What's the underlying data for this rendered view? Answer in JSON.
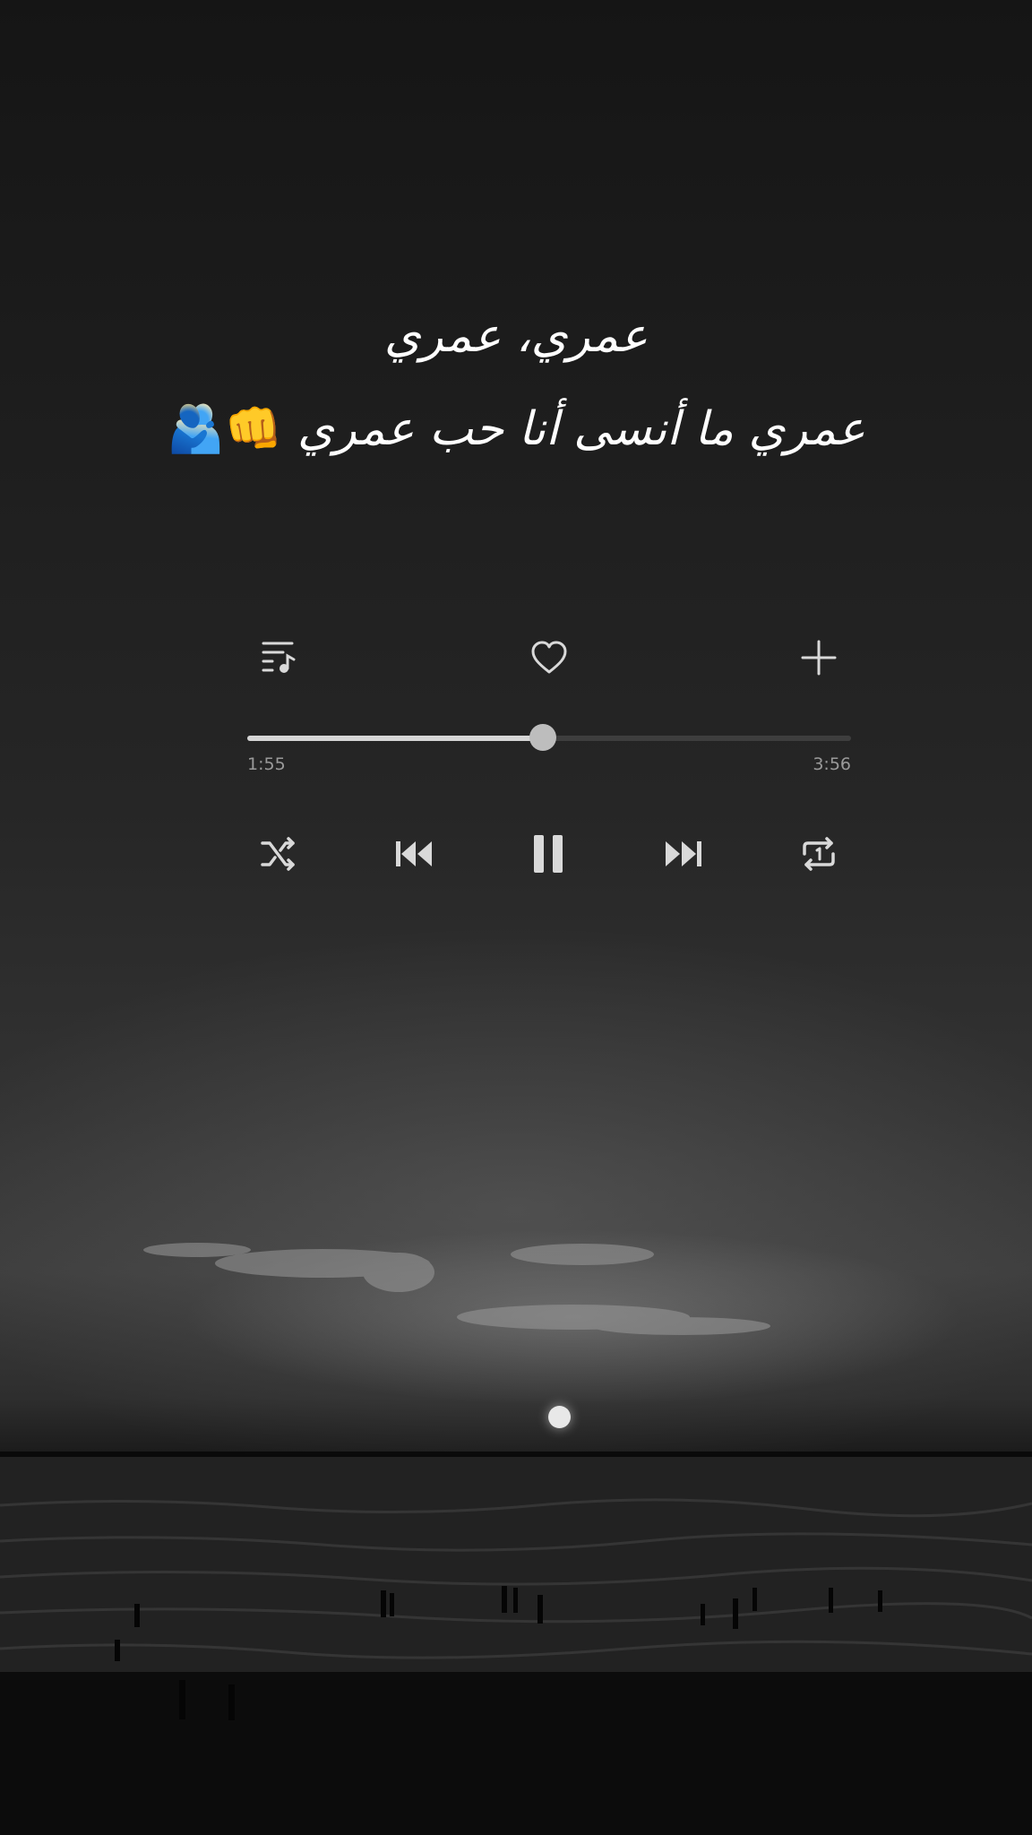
{
  "lyrics": {
    "line1": "عمري، عمري",
    "line2_text": "عمري ما أنسى أنا حب عمري",
    "line2_emoji": "👊🫂"
  },
  "player": {
    "progress_fraction": 0.49,
    "time_elapsed": "1:55",
    "time_total": "3:56",
    "top_controls": [
      "playlist-icon",
      "heart-icon",
      "plus-icon"
    ],
    "transport_controls": [
      "shuffle-icon",
      "previous-icon",
      "pause-icon",
      "next-icon",
      "repeat-one-icon"
    ],
    "icon_color": "#d9d9d9",
    "track_color": "#d6d6d6"
  }
}
